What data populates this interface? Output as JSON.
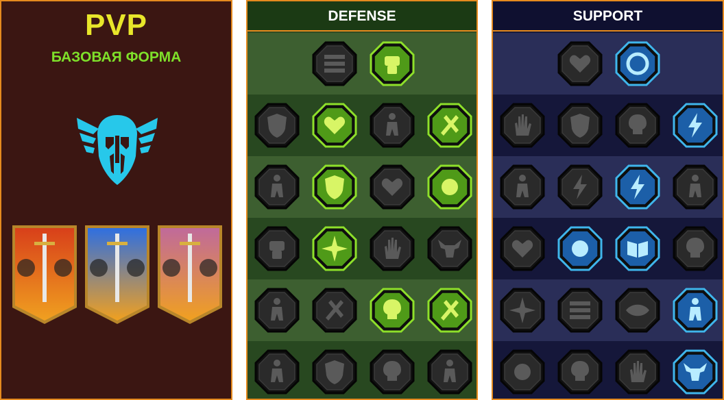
{
  "pvp": {
    "title": "PVP",
    "subtitle": "БАЗОВАЯ ФОРМА",
    "emblem_icon": "winged-helmet-icon",
    "banners": [
      {
        "icon": "red-knights-banner",
        "color": "#d8401a"
      },
      {
        "icon": "blue-knights-banner",
        "color": "#2f6fe0"
      },
      {
        "icon": "crossed-swords-banner",
        "color": "#c06a9a"
      }
    ]
  },
  "defense": {
    "title": "DEFENSE",
    "active_color": "#8ee02a",
    "rows": [
      [
        {
          "icon": "shield-wall-icon",
          "active": false
        },
        {
          "icon": "raised-fist-icon",
          "active": true
        }
      ],
      [
        {
          "icon": "armor-plate-icon",
          "active": false
        },
        {
          "icon": "heart-hand-icon",
          "active": true
        },
        {
          "icon": "stone-golem-icon",
          "active": false
        },
        {
          "icon": "crossed-blades-icon",
          "active": true
        }
      ],
      [
        {
          "icon": "fighter-stance-icon",
          "active": false
        },
        {
          "icon": "knight-shield-icon",
          "active": true
        },
        {
          "icon": "dark-heart-icon",
          "active": false
        },
        {
          "icon": "halo-hero-icon",
          "active": true
        }
      ],
      [
        {
          "icon": "crowd-fist-icon",
          "active": false
        },
        {
          "icon": "hourglass-icon",
          "active": true
        },
        {
          "icon": "open-palm-icon",
          "active": false
        },
        {
          "icon": "bull-head-icon",
          "active": false
        }
      ],
      [
        {
          "icon": "dash-runner-icon",
          "active": false
        },
        {
          "icon": "claw-marks-icon",
          "active": false
        },
        {
          "icon": "radiant-skull-icon",
          "active": true
        },
        {
          "icon": "dodge-slash-icon",
          "active": true
        }
      ],
      [
        {
          "icon": "warrior-bust-icon",
          "active": false
        },
        {
          "icon": "winged-shield-icon",
          "active": false
        },
        {
          "icon": "ancient-face-icon",
          "active": false
        },
        {
          "icon": "flexing-body-icon",
          "active": false
        }
      ]
    ]
  },
  "support": {
    "title": "SUPPORT",
    "active_color": "#3fb6ec",
    "rows": [
      [
        {
          "icon": "heart-plus-icon",
          "active": false
        },
        {
          "icon": "speed-wheel-icon",
          "active": true
        }
      ],
      [
        {
          "icon": "praying-hands-icon",
          "active": false
        },
        {
          "icon": "aura-shield-icon",
          "active": false
        },
        {
          "icon": "smoke-skull-icon",
          "active": false
        },
        {
          "icon": "swift-strike-icon",
          "active": true
        }
      ],
      [
        {
          "icon": "sparkle-figure-icon",
          "active": false
        },
        {
          "icon": "lightning-shield-icon",
          "active": false
        },
        {
          "icon": "shatter-bolt-icon",
          "active": true
        },
        {
          "icon": "shadow-duo-icon",
          "active": false
        }
      ],
      [
        {
          "icon": "chained-heart-icon",
          "active": false
        },
        {
          "icon": "comet-icon",
          "active": true
        },
        {
          "icon": "open-book-icon",
          "active": true
        },
        {
          "icon": "fury-face-icon",
          "active": false
        }
      ],
      [
        {
          "icon": "compass-star-icon",
          "active": false
        },
        {
          "icon": "boot-dash-icon",
          "active": false
        },
        {
          "icon": "all-seeing-eye-icon",
          "active": false
        },
        {
          "icon": "voodoo-doll-icon",
          "active": true
        }
      ],
      [
        {
          "icon": "poison-flask-icon",
          "active": false
        },
        {
          "icon": "horned-skull-icon",
          "active": false
        },
        {
          "icon": "demon-hand-icon",
          "active": false
        },
        {
          "icon": "eagle-head-icon",
          "active": true
        }
      ]
    ]
  }
}
